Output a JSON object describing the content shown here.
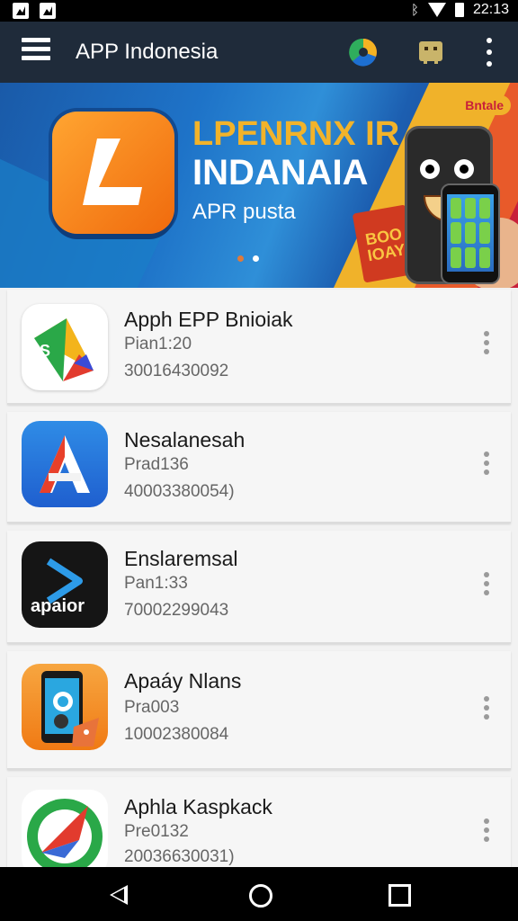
{
  "status_bar": {
    "time": "22:13"
  },
  "toolbar": {
    "title": "APP Indonesia"
  },
  "banner": {
    "headline_line1": "LPENRNX IR",
    "headline_line2": "INDANAIA",
    "subtitle": "APR pusta",
    "badge": "Bntale",
    "ticket_text": "BOO\nIOAY",
    "active_dot": 1,
    "dot_count": 2,
    "colors": {
      "active_dot": "#ffffff",
      "inactive_dot": "#e07a3a"
    }
  },
  "apps": [
    {
      "name": "Apph EPP Bnioiak",
      "line1": "Pian1:20",
      "line2": "30016430092",
      "icon": "triangle-a-icon"
    },
    {
      "name": "Nesalanesah",
      "line1": "Prad136",
      "line2": "40003380054)",
      "icon": "letter-a-icon"
    },
    {
      "name": "Enslaremsal",
      "line1": "Pan1:33",
      "line2": "70002299043",
      "icon": "apaior-icon"
    },
    {
      "name": "Apaáy Nlans",
      "line1": "Pra003",
      "line2": "10002380084",
      "icon": "phone-fox-icon"
    },
    {
      "name": "Aphla Kaspkack",
      "line1": "Pre0132",
      "line2": "20036630031)",
      "icon": "compass-icon"
    }
  ],
  "icon_text": {
    "apaior": "apaior"
  },
  "colors": {
    "toolbar_bg": "#1f2b3a",
    "accent_orange": "#f07a14",
    "card_bg": "#f6f6f6"
  }
}
